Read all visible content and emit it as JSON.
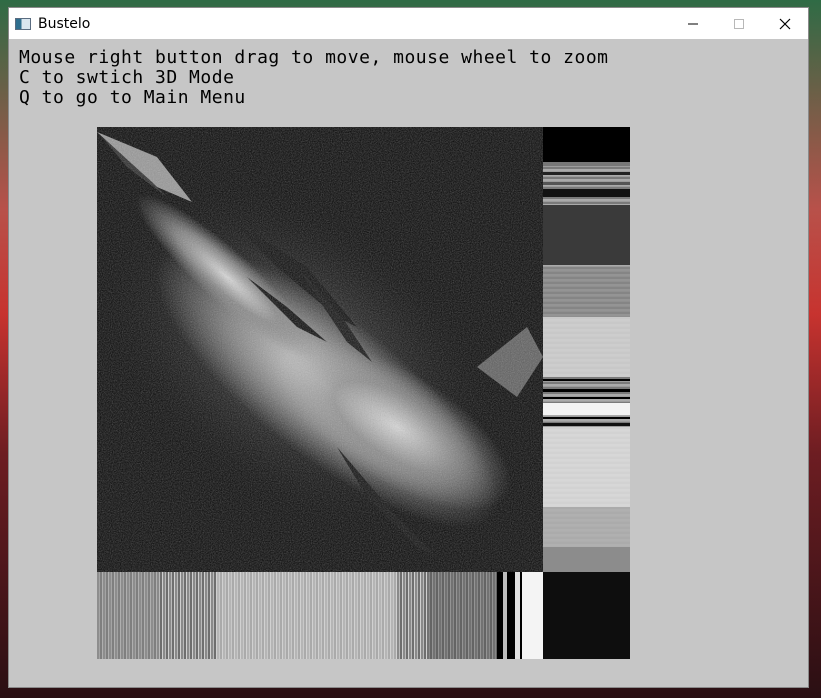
{
  "window": {
    "title": "Bustelo",
    "icon": "app-window-icon",
    "controls": [
      "minimize-icon",
      "maximize-icon",
      "close-icon"
    ]
  },
  "instructions": {
    "line1": "Mouse right button drag to move, mouse wheel to zoom",
    "line2": "C to swtich 3D Mode",
    "line3": "Q to go to Main Menu"
  },
  "colors": {
    "window_bg": "#c6c6c6",
    "plot_bg": "#000000",
    "titlebar_bg": "#ffffff"
  }
}
